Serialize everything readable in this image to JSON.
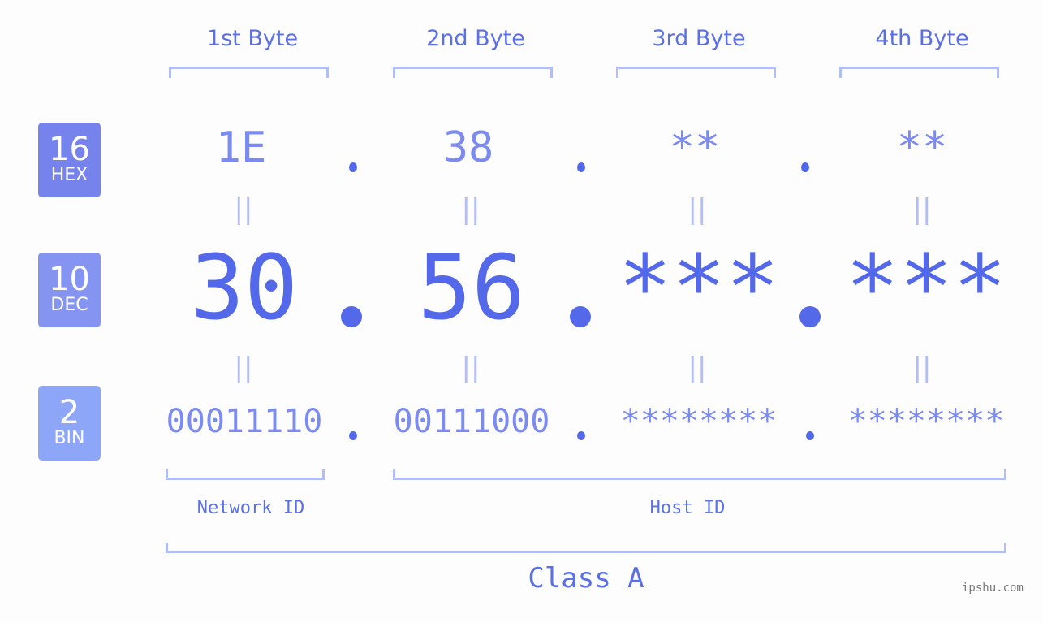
{
  "headers": [
    "1st Byte",
    "2nd Byte",
    "3rd Byte",
    "4th Byte"
  ],
  "badges": [
    {
      "num": "16",
      "label": "HEX",
      "color": "#7683ec"
    },
    {
      "num": "10",
      "label": "DEC",
      "color": "#8494f0"
    },
    {
      "num": "2",
      "label": "BIN",
      "color": "#8ea6f8"
    }
  ],
  "hex": [
    "1E",
    "38",
    "**",
    "**"
  ],
  "dec": [
    "30",
    "56",
    "***",
    "***"
  ],
  "bin": [
    "00011110",
    "00111000",
    "********",
    "********"
  ],
  "equals_sign": "||",
  "network_label": "Network ID",
  "host_label": "Host ID",
  "class_label": "Class A",
  "watermark": "ipshu.com"
}
